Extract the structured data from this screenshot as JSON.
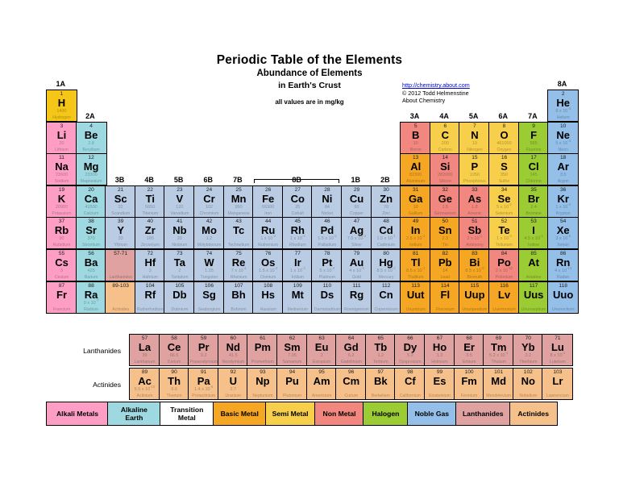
{
  "header": {
    "title": "Periodic Table of the Elements",
    "subtitle": "Abundance of Elements",
    "subtitle2": "in Earth's Crust",
    "units_note": "all values are in mg/kg",
    "credit_url": "http://chemistry.about.com",
    "credit_line1": "© 2012 Todd Helmenstine",
    "credit_line2": "About Chemistry"
  },
  "group_labels": [
    "1A",
    "2A",
    "3B",
    "4B",
    "5B",
    "6B",
    "7B",
    "8B",
    "1B",
    "2B",
    "3A",
    "4A",
    "5A",
    "6A",
    "7A",
    "8A"
  ],
  "fblock_labels": {
    "lanthanides": "Lanthanides",
    "actinides": "Actinides"
  },
  "colors": {
    "alkali": "#ff9ec4",
    "alkaline_earth": "#9ed8e0",
    "transition": "#b9cce4",
    "basic_metal": "#f5a623",
    "semi_metal": "#f7cf4b",
    "nonmetal": "#f2877f",
    "halogen": "#9ccc34",
    "noble": "#93bfe8",
    "lanthanide": "#dfa2a0",
    "actinide": "#f5c08a",
    "border": "#000000",
    "link": "#0000cc"
  },
  "legend": [
    {
      "label": "Alkali Metals",
      "color": "#ff9ec4",
      "width": 78
    },
    {
      "label": "Alkaline\nEarth",
      "color": "#9ed8e0",
      "width": 66
    },
    {
      "label": "Transition\nMetal",
      "color": "#ffffff",
      "width": 68
    },
    {
      "label": "Basic Metal",
      "color": "#f5a623",
      "width": 66
    },
    {
      "label": "Semi Metal",
      "color": "#f7cf4b",
      "width": 63
    },
    {
      "label": "Non Metal",
      "color": "#f2877f",
      "width": 62
    },
    {
      "label": "Halogen",
      "color": "#9ccc34",
      "width": 56
    },
    {
      "label": "Noble Gas",
      "color": "#93bfe8",
      "width": 62
    },
    {
      "label": "Lanthanides",
      "color": "#dfa2a0",
      "width": 68
    },
    {
      "label": "Actinides",
      "color": "#f5c08a",
      "width": 60
    }
  ],
  "elements": [
    {
      "z": "1",
      "sym": "H",
      "name": "Hydrogen",
      "ab": "1400",
      "g": 1,
      "p": 1,
      "cat": "semi_metal_h"
    },
    {
      "z": "2",
      "sym": "He",
      "name": "Helium",
      "ab": "8 x 10<sup>-3</sup>",
      "g": 18,
      "p": 1,
      "cat": "noble"
    },
    {
      "z": "3",
      "sym": "Li",
      "name": "Lithium",
      "ab": "20",
      "g": 1,
      "p": 2,
      "cat": "alkali"
    },
    {
      "z": "4",
      "sym": "Be",
      "name": "Beryllium",
      "ab": "2.8",
      "g": 2,
      "p": 2,
      "cat": "alkaline_earth"
    },
    {
      "z": "5",
      "sym": "B",
      "name": "Boron",
      "ab": "10",
      "g": 13,
      "p": 2,
      "cat": "nonmetal"
    },
    {
      "z": "6",
      "sym": "C",
      "name": "Carbon",
      "ab": "200",
      "g": 14,
      "p": 2,
      "cat": "semi_metal"
    },
    {
      "z": "7",
      "sym": "N",
      "name": "Nitrogen",
      "ab": "19",
      "g": 15,
      "p": 2,
      "cat": "semi_metal"
    },
    {
      "z": "8",
      "sym": "O",
      "name": "Oxygen",
      "ab": "461000",
      "g": 16,
      "p": 2,
      "cat": "semi_metal"
    },
    {
      "z": "9",
      "sym": "F",
      "name": "Fluorine",
      "ab": "585",
      "g": 17,
      "p": 2,
      "cat": "halogen"
    },
    {
      "z": "10",
      "sym": "Ne",
      "name": "Neon",
      "ab": "5 x 10<sup>-3</sup>",
      "g": 18,
      "p": 2,
      "cat": "noble"
    },
    {
      "z": "11",
      "sym": "Na",
      "name": "Sodium",
      "ab": "23600",
      "g": 1,
      "p": 3,
      "cat": "alkali"
    },
    {
      "z": "12",
      "sym": "Mg",
      "name": "Magnesium",
      "ab": "23300",
      "g": 2,
      "p": 3,
      "cat": "alkaline_earth"
    },
    {
      "z": "13",
      "sym": "Al",
      "name": "Aluminum",
      "ab": "82300",
      "g": 13,
      "p": 3,
      "cat": "basic_metal"
    },
    {
      "z": "14",
      "sym": "Si",
      "name": "Silicon",
      "ab": "282000",
      "g": 14,
      "p": 3,
      "cat": "nonmetal"
    },
    {
      "z": "15",
      "sym": "P",
      "name": "Phosphorus",
      "ab": "1050",
      "g": 15,
      "p": 3,
      "cat": "semi_metal"
    },
    {
      "z": "16",
      "sym": "S",
      "name": "Sulfur",
      "ab": "350",
      "g": 16,
      "p": 3,
      "cat": "semi_metal"
    },
    {
      "z": "17",
      "sym": "Cl",
      "name": "Chlorine",
      "ab": "145",
      "g": 17,
      "p": 3,
      "cat": "halogen"
    },
    {
      "z": "18",
      "sym": "Ar",
      "name": "Argon",
      "ab": "3.5",
      "g": 18,
      "p": 3,
      "cat": "noble"
    },
    {
      "z": "19",
      "sym": "K",
      "name": "Potassium",
      "ab": "20900",
      "g": 1,
      "p": 4,
      "cat": "alkali"
    },
    {
      "z": "20",
      "sym": "Ca",
      "name": "Calcium",
      "ab": "41500",
      "g": 2,
      "p": 4,
      "cat": "alkaline_earth"
    },
    {
      "z": "21",
      "sym": "Sc",
      "name": "Scandium",
      "ab": "22",
      "g": 3,
      "p": 4,
      "cat": "transition"
    },
    {
      "z": "22",
      "sym": "Ti",
      "name": "Titanium",
      "ab": "5650",
      "g": 4,
      "p": 4,
      "cat": "transition"
    },
    {
      "z": "23",
      "sym": "V",
      "name": "Vanadium",
      "ab": "120",
      "g": 5,
      "p": 4,
      "cat": "transition"
    },
    {
      "z": "24",
      "sym": "Cr",
      "name": "Chromium",
      "ab": "102",
      "g": 6,
      "p": 4,
      "cat": "transition"
    },
    {
      "z": "25",
      "sym": "Mn",
      "name": "Manganese",
      "ab": "950",
      "g": 7,
      "p": 4,
      "cat": "transition"
    },
    {
      "z": "26",
      "sym": "Fe",
      "name": "Iron",
      "ab": "56300",
      "g": 8,
      "p": 4,
      "cat": "transition"
    },
    {
      "z": "27",
      "sym": "Co",
      "name": "Cobalt",
      "ab": "25",
      "g": 9,
      "p": 4,
      "cat": "transition"
    },
    {
      "z": "28",
      "sym": "Ni",
      "name": "Nickel",
      "ab": "84",
      "g": 10,
      "p": 4,
      "cat": "transition"
    },
    {
      "z": "29",
      "sym": "Cu",
      "name": "Copper",
      "ab": "60",
      "g": 11,
      "p": 4,
      "cat": "transition"
    },
    {
      "z": "30",
      "sym": "Zn",
      "name": "Zinc",
      "ab": "70",
      "g": 12,
      "p": 4,
      "cat": "transition"
    },
    {
      "z": "31",
      "sym": "Ga",
      "name": "Gallium",
      "ab": "19",
      "g": 13,
      "p": 4,
      "cat": "basic_metal"
    },
    {
      "z": "32",
      "sym": "Ge",
      "name": "Germanium",
      "ab": "1.5",
      "g": 14,
      "p": 4,
      "cat": "nonmetal"
    },
    {
      "z": "33",
      "sym": "As",
      "name": "Arsenic",
      "ab": "1.8",
      "g": 15,
      "p": 4,
      "cat": "nonmetal"
    },
    {
      "z": "34",
      "sym": "Se",
      "name": "Selenium",
      "ab": "5 x 10<sup>-2</sup>",
      "g": 16,
      "p": 4,
      "cat": "semi_metal"
    },
    {
      "z": "35",
      "sym": "Br",
      "name": "Bromine",
      "ab": "2.4",
      "g": 17,
      "p": 4,
      "cat": "halogen"
    },
    {
      "z": "36",
      "sym": "Kr",
      "name": "Krypton",
      "ab": "1 x 10<sup>-4</sup>",
      "g": 18,
      "p": 4,
      "cat": "noble"
    },
    {
      "z": "37",
      "sym": "Rb",
      "name": "Rubidium",
      "ab": "90",
      "g": 1,
      "p": 5,
      "cat": "alkali"
    },
    {
      "z": "38",
      "sym": "Sr",
      "name": "Strontium",
      "ab": "370",
      "g": 2,
      "p": 5,
      "cat": "alkaline_earth"
    },
    {
      "z": "39",
      "sym": "Y",
      "name": "Yttrium",
      "ab": "33",
      "g": 3,
      "p": 5,
      "cat": "transition"
    },
    {
      "z": "40",
      "sym": "Zr",
      "name": "Zirconium",
      "ab": "165",
      "g": 4,
      "p": 5,
      "cat": "transition"
    },
    {
      "z": "41",
      "sym": "Nb",
      "name": "Niobium",
      "ab": "20",
      "g": 5,
      "p": 5,
      "cat": "transition"
    },
    {
      "z": "42",
      "sym": "Mo",
      "name": "Molybdenum",
      "ab": "1.2",
      "g": 6,
      "p": 5,
      "cat": "transition"
    },
    {
      "z": "43",
      "sym": "Tc",
      "name": "Technetium",
      "ab": "",
      "g": 7,
      "p": 5,
      "cat": "transition"
    },
    {
      "z": "44",
      "sym": "Ru",
      "name": "Ruthenium",
      "ab": "1 x 10<sup>-3</sup>",
      "g": 8,
      "p": 5,
      "cat": "transition"
    },
    {
      "z": "45",
      "sym": "Rh",
      "name": "Rhodium",
      "ab": "1 x 10<sup>-3</sup>",
      "g": 9,
      "p": 5,
      "cat": "transition"
    },
    {
      "z": "46",
      "sym": "Pd",
      "name": "Palladium",
      "ab": "1.5 x 10<sup>-2</sup>",
      "g": 10,
      "p": 5,
      "cat": "transition"
    },
    {
      "z": "47",
      "sym": "Ag",
      "name": "Silver",
      "ab": "7.5 x 10<sup>-2</sup>",
      "g": 11,
      "p": 5,
      "cat": "transition"
    },
    {
      "z": "48",
      "sym": "Cd",
      "name": "Cadmium",
      "ab": "1.5 x 10<sup>-1</sup>",
      "g": 12,
      "p": 5,
      "cat": "transition"
    },
    {
      "z": "49",
      "sym": "In",
      "name": "Indium",
      "ab": "2.5 x 10<sup>-1</sup>",
      "g": 13,
      "p": 5,
      "cat": "basic_metal"
    },
    {
      "z": "50",
      "sym": "Sn",
      "name": "Tin",
      "ab": "2.3",
      "g": 14,
      "p": 5,
      "cat": "basic_metal"
    },
    {
      "z": "51",
      "sym": "Sb",
      "name": "Antimony",
      "ab": "2 x 10<sup>-1</sup>",
      "g": 15,
      "p": 5,
      "cat": "nonmetal"
    },
    {
      "z": "52",
      "sym": "Te",
      "name": "Tellurium",
      "ab": "1 x 10<sup>-3</sup>",
      "g": 16,
      "p": 5,
      "cat": "semi_metal"
    },
    {
      "z": "53",
      "sym": "I",
      "name": "Iodine",
      "ab": "4.5 x 10<sup>-1</sup>",
      "g": 17,
      "p": 5,
      "cat": "halogen"
    },
    {
      "z": "54",
      "sym": "Xe",
      "name": "Xenon",
      "ab": "3 x 10<sup>-5</sup>",
      "g": 18,
      "p": 5,
      "cat": "noble"
    },
    {
      "z": "55",
      "sym": "Cs",
      "name": "Cesium",
      "ab": "3",
      "g": 1,
      "p": 6,
      "cat": "alkali"
    },
    {
      "z": "56",
      "sym": "Ba",
      "name": "Barium",
      "ab": "425",
      "g": 2,
      "p": 6,
      "cat": "alkaline_earth"
    },
    {
      "z": "57-71",
      "sym": "",
      "name": "Lanthanides",
      "ab": "",
      "g": 3,
      "p": 6,
      "cat": "lanthanide",
      "placeholder": true
    },
    {
      "z": "72",
      "sym": "Hf",
      "name": "Hafnium",
      "ab": "3",
      "g": 4,
      "p": 6,
      "cat": "transition"
    },
    {
      "z": "73",
      "sym": "Ta",
      "name": "Tantalum",
      "ab": "2",
      "g": 5,
      "p": 6,
      "cat": "transition"
    },
    {
      "z": "74",
      "sym": "W",
      "name": "Tungsten",
      "ab": "1.25",
      "g": 6,
      "p": 6,
      "cat": "transition"
    },
    {
      "z": "75",
      "sym": "Re",
      "name": "Rhenium",
      "ab": "7 x 10<sup>-4</sup>",
      "g": 7,
      "p": 6,
      "cat": "transition"
    },
    {
      "z": "76",
      "sym": "Os",
      "name": "Osmium",
      "ab": "1.5 x 10<sup>-3</sup>",
      "g": 8,
      "p": 6,
      "cat": "transition"
    },
    {
      "z": "77",
      "sym": "Ir",
      "name": "Iridium",
      "ab": "1 x 10<sup>-3</sup>",
      "g": 9,
      "p": 6,
      "cat": "transition"
    },
    {
      "z": "78",
      "sym": "Pt",
      "name": "Platinum",
      "ab": "5 x 10<sup>-3</sup>",
      "g": 10,
      "p": 6,
      "cat": "transition"
    },
    {
      "z": "79",
      "sym": "Au",
      "name": "Gold",
      "ab": "4 x 10<sup>-3</sup>",
      "g": 11,
      "p": 6,
      "cat": "transition"
    },
    {
      "z": "80",
      "sym": "Hg",
      "name": "Mercury",
      "ab": "8.5 x 10<sup>-2</sup>",
      "g": 12,
      "p": 6,
      "cat": "transition"
    },
    {
      "z": "81",
      "sym": "Tl",
      "name": "Thallium",
      "ab": "8.5 x 10<sup>-1</sup>",
      "g": 13,
      "p": 6,
      "cat": "basic_metal"
    },
    {
      "z": "82",
      "sym": "Pb",
      "name": "Lead",
      "ab": "14",
      "g": 14,
      "p": 6,
      "cat": "basic_metal"
    },
    {
      "z": "83",
      "sym": "Bi",
      "name": "Bismuth",
      "ab": "8.5 x 10<sup>-3</sup>",
      "g": 15,
      "p": 6,
      "cat": "basic_metal"
    },
    {
      "z": "84",
      "sym": "Po",
      "name": "Polonium",
      "ab": "2 x 10<sup>-10</sup>",
      "g": 16,
      "p": 6,
      "cat": "nonmetal"
    },
    {
      "z": "85",
      "sym": "At",
      "name": "Astatine",
      "ab": "",
      "g": 17,
      "p": 6,
      "cat": "halogen"
    },
    {
      "z": "86",
      "sym": "Rn",
      "name": "Radon",
      "ab": "4 x 10<sup>-13</sup>",
      "g": 18,
      "p": 6,
      "cat": "noble"
    },
    {
      "z": "87",
      "sym": "Fr",
      "name": "Francium",
      "ab": "",
      "g": 1,
      "p": 7,
      "cat": "alkali"
    },
    {
      "z": "88",
      "sym": "Ra",
      "name": "Radium",
      "ab": "9 x 10<sup>-7</sup>",
      "g": 2,
      "p": 7,
      "cat": "alkaline_earth"
    },
    {
      "z": "89-103",
      "sym": "",
      "name": "Actinides",
      "ab": "",
      "g": 3,
      "p": 7,
      "cat": "actinide",
      "placeholder": true
    },
    {
      "z": "104",
      "sym": "Rf",
      "name": "Rutherfordium",
      "ab": "",
      "g": 4,
      "p": 7,
      "cat": "transition"
    },
    {
      "z": "105",
      "sym": "Db",
      "name": "Dubnium",
      "ab": "",
      "g": 5,
      "p": 7,
      "cat": "transition"
    },
    {
      "z": "106",
      "sym": "Sg",
      "name": "Seaborgium",
      "ab": "",
      "g": 6,
      "p": 7,
      "cat": "transition"
    },
    {
      "z": "107",
      "sym": "Bh",
      "name": "Bohrium",
      "ab": "",
      "g": 7,
      "p": 7,
      "cat": "transition"
    },
    {
      "z": "108",
      "sym": "Hs",
      "name": "Hassium",
      "ab": "",
      "g": 8,
      "p": 7,
      "cat": "transition"
    },
    {
      "z": "109",
      "sym": "Mt",
      "name": "Meitnerium",
      "ab": "",
      "g": 9,
      "p": 7,
      "cat": "transition"
    },
    {
      "z": "110",
      "sym": "Ds",
      "name": "Darmstadtium",
      "ab": "",
      "g": 10,
      "p": 7,
      "cat": "transition"
    },
    {
      "z": "111",
      "sym": "Rg",
      "name": "Roentgenium",
      "ab": "",
      "g": 11,
      "p": 7,
      "cat": "transition"
    },
    {
      "z": "112",
      "sym": "Cn",
      "name": "Copernicium",
      "ab": "",
      "g": 12,
      "p": 7,
      "cat": "transition"
    },
    {
      "z": "113",
      "sym": "Uut",
      "name": "Ununtrium",
      "ab": "",
      "g": 13,
      "p": 7,
      "cat": "basic_metal"
    },
    {
      "z": "114",
      "sym": "Fl",
      "name": "Flerovium",
      "ab": "",
      "g": 14,
      "p": 7,
      "cat": "basic_metal"
    },
    {
      "z": "115",
      "sym": "Uup",
      "name": "Ununpentium",
      "ab": "",
      "g": 15,
      "p": 7,
      "cat": "basic_metal"
    },
    {
      "z": "116",
      "sym": "Lv",
      "name": "Livermorium",
      "ab": "",
      "g": 16,
      "p": 7,
      "cat": "basic_metal"
    },
    {
      "z": "117",
      "sym": "Uus",
      "name": "Ununseptium",
      "ab": "",
      "g": 17,
      "p": 7,
      "cat": "halogen"
    },
    {
      "z": "118",
      "sym": "Uuo",
      "name": "Ununoctium",
      "ab": "",
      "g": 18,
      "p": 7,
      "cat": "noble"
    }
  ],
  "lanthanides": [
    {
      "z": "57",
      "sym": "La",
      "name": "Lanthanum",
      "ab": "39"
    },
    {
      "z": "58",
      "sym": "Ce",
      "name": "Cerium",
      "ab": "66.5"
    },
    {
      "z": "59",
      "sym": "Pr",
      "name": "Praseodymium",
      "ab": "9.2"
    },
    {
      "z": "60",
      "sym": "Nd",
      "name": "Neodymium",
      "ab": "41.5"
    },
    {
      "z": "61",
      "sym": "Pm",
      "name": "Promethium",
      "ab": ""
    },
    {
      "z": "62",
      "sym": "Sm",
      "name": "Samarium",
      "ab": "7.05"
    },
    {
      "z": "63",
      "sym": "Eu",
      "name": "Europium",
      "ab": "2"
    },
    {
      "z": "64",
      "sym": "Gd",
      "name": "Gadolinium",
      "ab": "6.2"
    },
    {
      "z": "65",
      "sym": "Tb",
      "name": "Terbium",
      "ab": "1.2"
    },
    {
      "z": "66",
      "sym": "Dy",
      "name": "Dysprosium",
      "ab": "5.2"
    },
    {
      "z": "67",
      "sym": "Ho",
      "name": "Holmium",
      "ab": "1.3"
    },
    {
      "z": "68",
      "sym": "Er",
      "name": "Erbium",
      "ab": "3.5"
    },
    {
      "z": "69",
      "sym": "Tm",
      "name": "Thulium",
      "ab": "5.2 x 10<sup>-1</sup>"
    },
    {
      "z": "70",
      "sym": "Yb",
      "name": "Ytterbium",
      "ab": "3.2"
    },
    {
      "z": "71",
      "sym": "Lu",
      "name": "Lutetium",
      "ab": "8 x 10<sup>-1</sup>"
    }
  ],
  "actinides": [
    {
      "z": "89",
      "sym": "Ac",
      "name": "Actinium",
      "ab": "5.5 x 10<sup>-10</sup>"
    },
    {
      "z": "90",
      "sym": "Th",
      "name": "Thorium",
      "ab": "9.6"
    },
    {
      "z": "91",
      "sym": "Pa",
      "name": "Protactinium",
      "ab": "1.4 x 10<sup>-6</sup>"
    },
    {
      "z": "92",
      "sym": "U",
      "name": "Uranium",
      "ab": "2.7"
    },
    {
      "z": "93",
      "sym": "Np",
      "name": "Neptunium",
      "ab": ""
    },
    {
      "z": "94",
      "sym": "Pu",
      "name": "Plutonium",
      "ab": ""
    },
    {
      "z": "95",
      "sym": "Am",
      "name": "Americium",
      "ab": ""
    },
    {
      "z": "96",
      "sym": "Cm",
      "name": "Curium",
      "ab": ""
    },
    {
      "z": "97",
      "sym": "Bk",
      "name": "Berkelium",
      "ab": ""
    },
    {
      "z": "98",
      "sym": "Cf",
      "name": "Californium",
      "ab": ""
    },
    {
      "z": "99",
      "sym": "Es",
      "name": "Einsteinium",
      "ab": ""
    },
    {
      "z": "100",
      "sym": "Fm",
      "name": "Fermium",
      "ab": ""
    },
    {
      "z": "101",
      "sym": "Md",
      "name": "Mendelevium",
      "ab": ""
    },
    {
      "z": "102",
      "sym": "No",
      "name": "Nobelium",
      "ab": ""
    },
    {
      "z": "103",
      "sym": "Lr",
      "name": "Lawrencium",
      "ab": ""
    }
  ]
}
